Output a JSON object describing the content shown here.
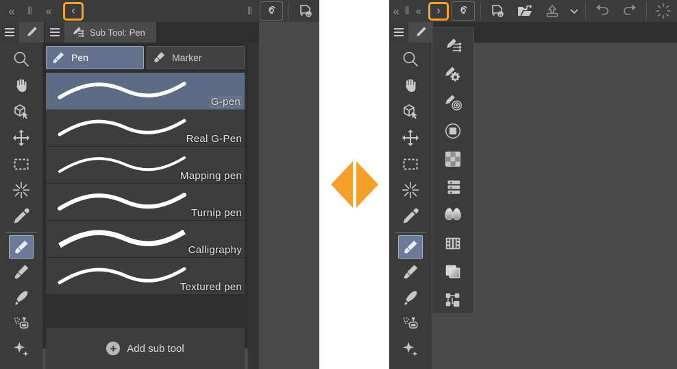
{
  "app": {
    "title_left": "Sub Tool: Pen",
    "title_right": ""
  },
  "titlebar": {
    "collapse_all_label": "«",
    "grip_label": "⦀",
    "collapse_label": "«",
    "left_arrow_label": "‹",
    "right_arrow_label": "›",
    "highlight_color": "#f5a623",
    "tools": [
      {
        "name": "clip-studio-logo-icon",
        "label": "CLIP STUDIO"
      },
      {
        "name": "new-document-icon",
        "label": "New"
      },
      {
        "name": "open-file-icon",
        "label": "Open"
      },
      {
        "name": "save-export-icon",
        "label": "Save"
      },
      {
        "name": "chevron-down-icon",
        "label": "⌄"
      },
      {
        "name": "undo-icon",
        "label": "Undo"
      },
      {
        "name": "redo-icon",
        "label": "Redo"
      },
      {
        "name": "burst-icon",
        "label": "Clear"
      }
    ]
  },
  "tab_bar": {
    "menu_label": "≡",
    "pencil_tab_label": "Tool",
    "subtool_tab_label": "Sub Tool: Pen"
  },
  "tool_palette": {
    "items": [
      {
        "name": "zoom-tool",
        "label": "Zoom",
        "selected": false
      },
      {
        "name": "hand-tool",
        "label": "Move canvas",
        "selected": false
      },
      {
        "name": "rotate-3d-tool",
        "label": "Operation",
        "selected": false
      },
      {
        "name": "move-tool",
        "label": "Move layer",
        "selected": false
      },
      {
        "name": "marquee-tool",
        "label": "Selection area",
        "selected": false
      },
      {
        "name": "magic-wand-tool",
        "label": "Auto select",
        "selected": false
      },
      {
        "name": "eyedropper-tool",
        "label": "Eyedropper",
        "selected": false
      },
      {
        "name": "pen-tool",
        "label": "Pen",
        "selected": true
      },
      {
        "name": "pencil-tool",
        "label": "Pencil",
        "selected": false
      },
      {
        "name": "brush-tool",
        "label": "Brush",
        "selected": false
      },
      {
        "name": "airbrush-tool",
        "label": "Airbrush",
        "selected": false
      },
      {
        "name": "decoration-tool",
        "label": "Decoration",
        "selected": false
      }
    ]
  },
  "sub_tool": {
    "categories": [
      {
        "name": "pen",
        "label": "Pen",
        "active": true
      },
      {
        "name": "marker",
        "label": "Marker",
        "active": false
      }
    ],
    "brushes": [
      {
        "name": "g-pen",
        "label": "G-pen",
        "selected": true
      },
      {
        "name": "real-g-pen",
        "label": "Real G-Pen",
        "selected": false
      },
      {
        "name": "mapping-pen",
        "label": "Mapping pen",
        "selected": false
      },
      {
        "name": "turnip-pen",
        "label": "Turnip pen",
        "selected": false
      },
      {
        "name": "calligraphy",
        "label": "Calligraphy",
        "selected": false
      },
      {
        "name": "textured-pen",
        "label": "Textured pen",
        "selected": false
      }
    ],
    "add_sub_tool_label": "Add sub tool",
    "add_icon_label": "+",
    "selected_background": "#5e6b84",
    "active_tab_background": "#64718c"
  },
  "palette_dock": {
    "items": [
      {
        "name": "sub-tool-palette-icon",
        "label": "Sub Tool"
      },
      {
        "name": "tool-property-palette-icon",
        "label": "Tool Property"
      },
      {
        "name": "brush-settings-palette-icon",
        "label": "Sub Tool Detail"
      },
      {
        "name": "color-circle-palette-icon",
        "label": "Color Circle"
      },
      {
        "name": "color-set-palette-icon",
        "label": "Color Set"
      },
      {
        "name": "layer-property-palette-icon",
        "label": "Layer Property"
      },
      {
        "name": "gradient-tones-palette-icon",
        "label": "Tones"
      },
      {
        "name": "animation-palette-icon",
        "label": "Timeline"
      },
      {
        "name": "layer-palette-icon",
        "label": "Layer"
      },
      {
        "name": "material-palette-icon",
        "label": "Material"
      }
    ]
  },
  "comparison": {
    "left_arrow_name": "left-arrow-marker",
    "right_arrow_name": "right-arrow-marker",
    "arrow_color": "#f5a02a"
  }
}
